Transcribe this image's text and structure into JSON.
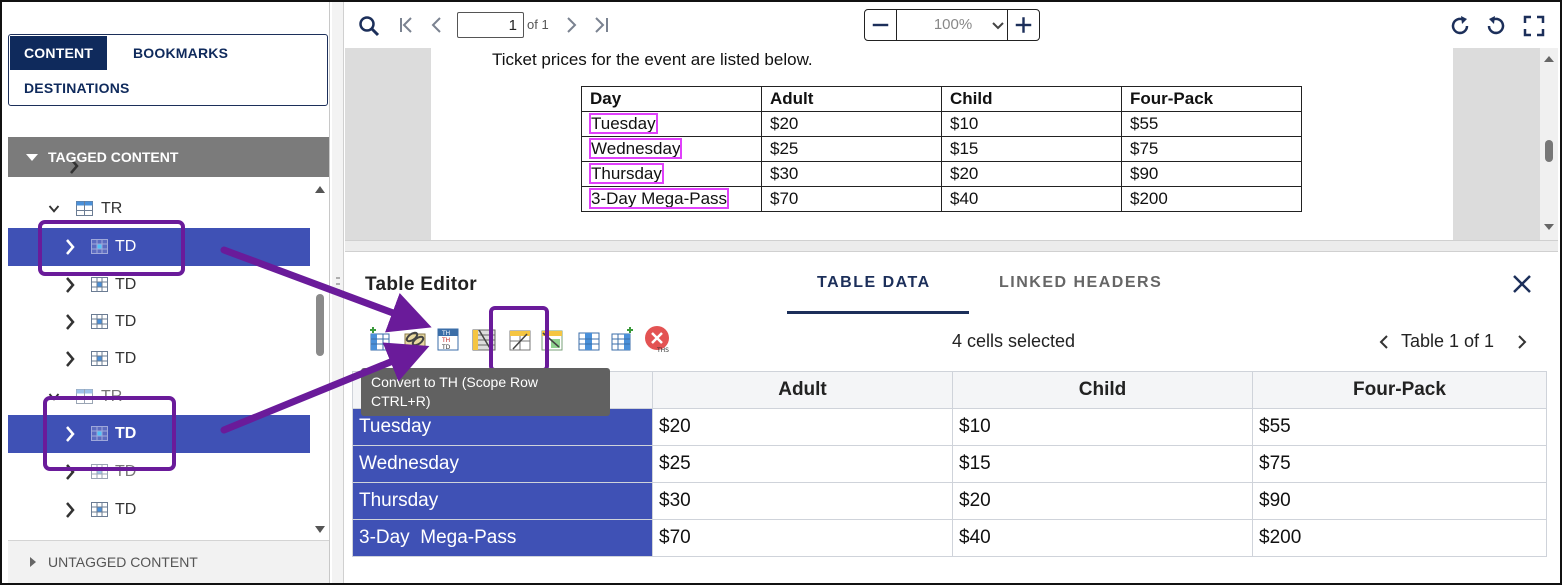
{
  "left_panel": {
    "tabs": [
      {
        "label": "CONTENT",
        "active": true
      },
      {
        "label": "BOOKMARKS",
        "active": false
      },
      {
        "label": "DESTINATIONS",
        "active": false
      }
    ],
    "tagged_header": "TAGGED CONTENT",
    "tree": [
      {
        "label": "TR",
        "expanded": true,
        "selected": false
      },
      {
        "label": "TD",
        "expanded": false,
        "selected": true
      },
      {
        "label": "TD",
        "expanded": false,
        "selected": false
      },
      {
        "label": "TD",
        "expanded": false,
        "selected": false
      },
      {
        "label": "TD",
        "expanded": false,
        "selected": false
      },
      {
        "label": "TR",
        "expanded": true,
        "selected": false
      },
      {
        "label": "TD",
        "expanded": false,
        "selected": true
      },
      {
        "label": "TD",
        "expanded": false,
        "selected": false
      },
      {
        "label": "TD",
        "expanded": false,
        "selected": false
      }
    ],
    "untagged_header": "UNTAGGED CONTENT"
  },
  "toolbar": {
    "page_value": "1",
    "page_of": "of 1",
    "zoom": "100%",
    "icons": [
      "search-icon",
      "first-page-icon",
      "prev-page-icon",
      "next-page-icon",
      "last-page-icon",
      "zoom-out-icon",
      "zoom-in-icon",
      "rotate-cw-icon",
      "rotate-ccw-icon",
      "fullscreen-icon"
    ]
  },
  "document": {
    "intro": "Ticket prices for the event are listed below.",
    "headers": [
      "Day",
      "Adult",
      "Child",
      "Four-Pack"
    ],
    "rows": [
      [
        "Tuesday",
        "$20",
        "$10",
        "$55"
      ],
      [
        "Wednesday",
        "$25",
        "$15",
        "$75"
      ],
      [
        "Thursday",
        "$30",
        "$20",
        "$90"
      ],
      [
        "3-Day Mega-Pass",
        "$70",
        "$40",
        "$200"
      ]
    ]
  },
  "editor": {
    "title": "Table Editor",
    "tabs": [
      {
        "label": "TABLE DATA",
        "active": true
      },
      {
        "label": "LINKED HEADERS",
        "active": false
      }
    ],
    "selection_text": "4 cells selected",
    "table_nav": "Table 1 of 1",
    "tooltip": "Convert to TH (Scope Row CTRL+R)",
    "tool_icons": [
      "insert-column-icon",
      "link-cells-icon",
      "th-td-icon",
      "convert-th-row-icon",
      "convert-th-column-icon",
      "delete-header-icon",
      "insert-row-icon",
      "insert-column-right-icon",
      "remove-ths-icon"
    ],
    "grid_headers": [
      "",
      "Adult",
      "Child",
      "Four-Pack"
    ],
    "grid_rows": [
      [
        "Tuesday",
        "$20",
        "$10",
        "$55"
      ],
      [
        "Wednesday",
        "$25",
        "$15",
        "$75"
      ],
      [
        "Thursday",
        "$30",
        "$20",
        "$90"
      ],
      [
        "3-Day  Mega-Pass",
        "$70",
        "$40",
        "$200"
      ]
    ]
  },
  "colors": {
    "selection": "#3f51b5",
    "navy": "#0f2a5c",
    "callout": "#6a1b9a",
    "tag_highlight": "#e040fb"
  }
}
